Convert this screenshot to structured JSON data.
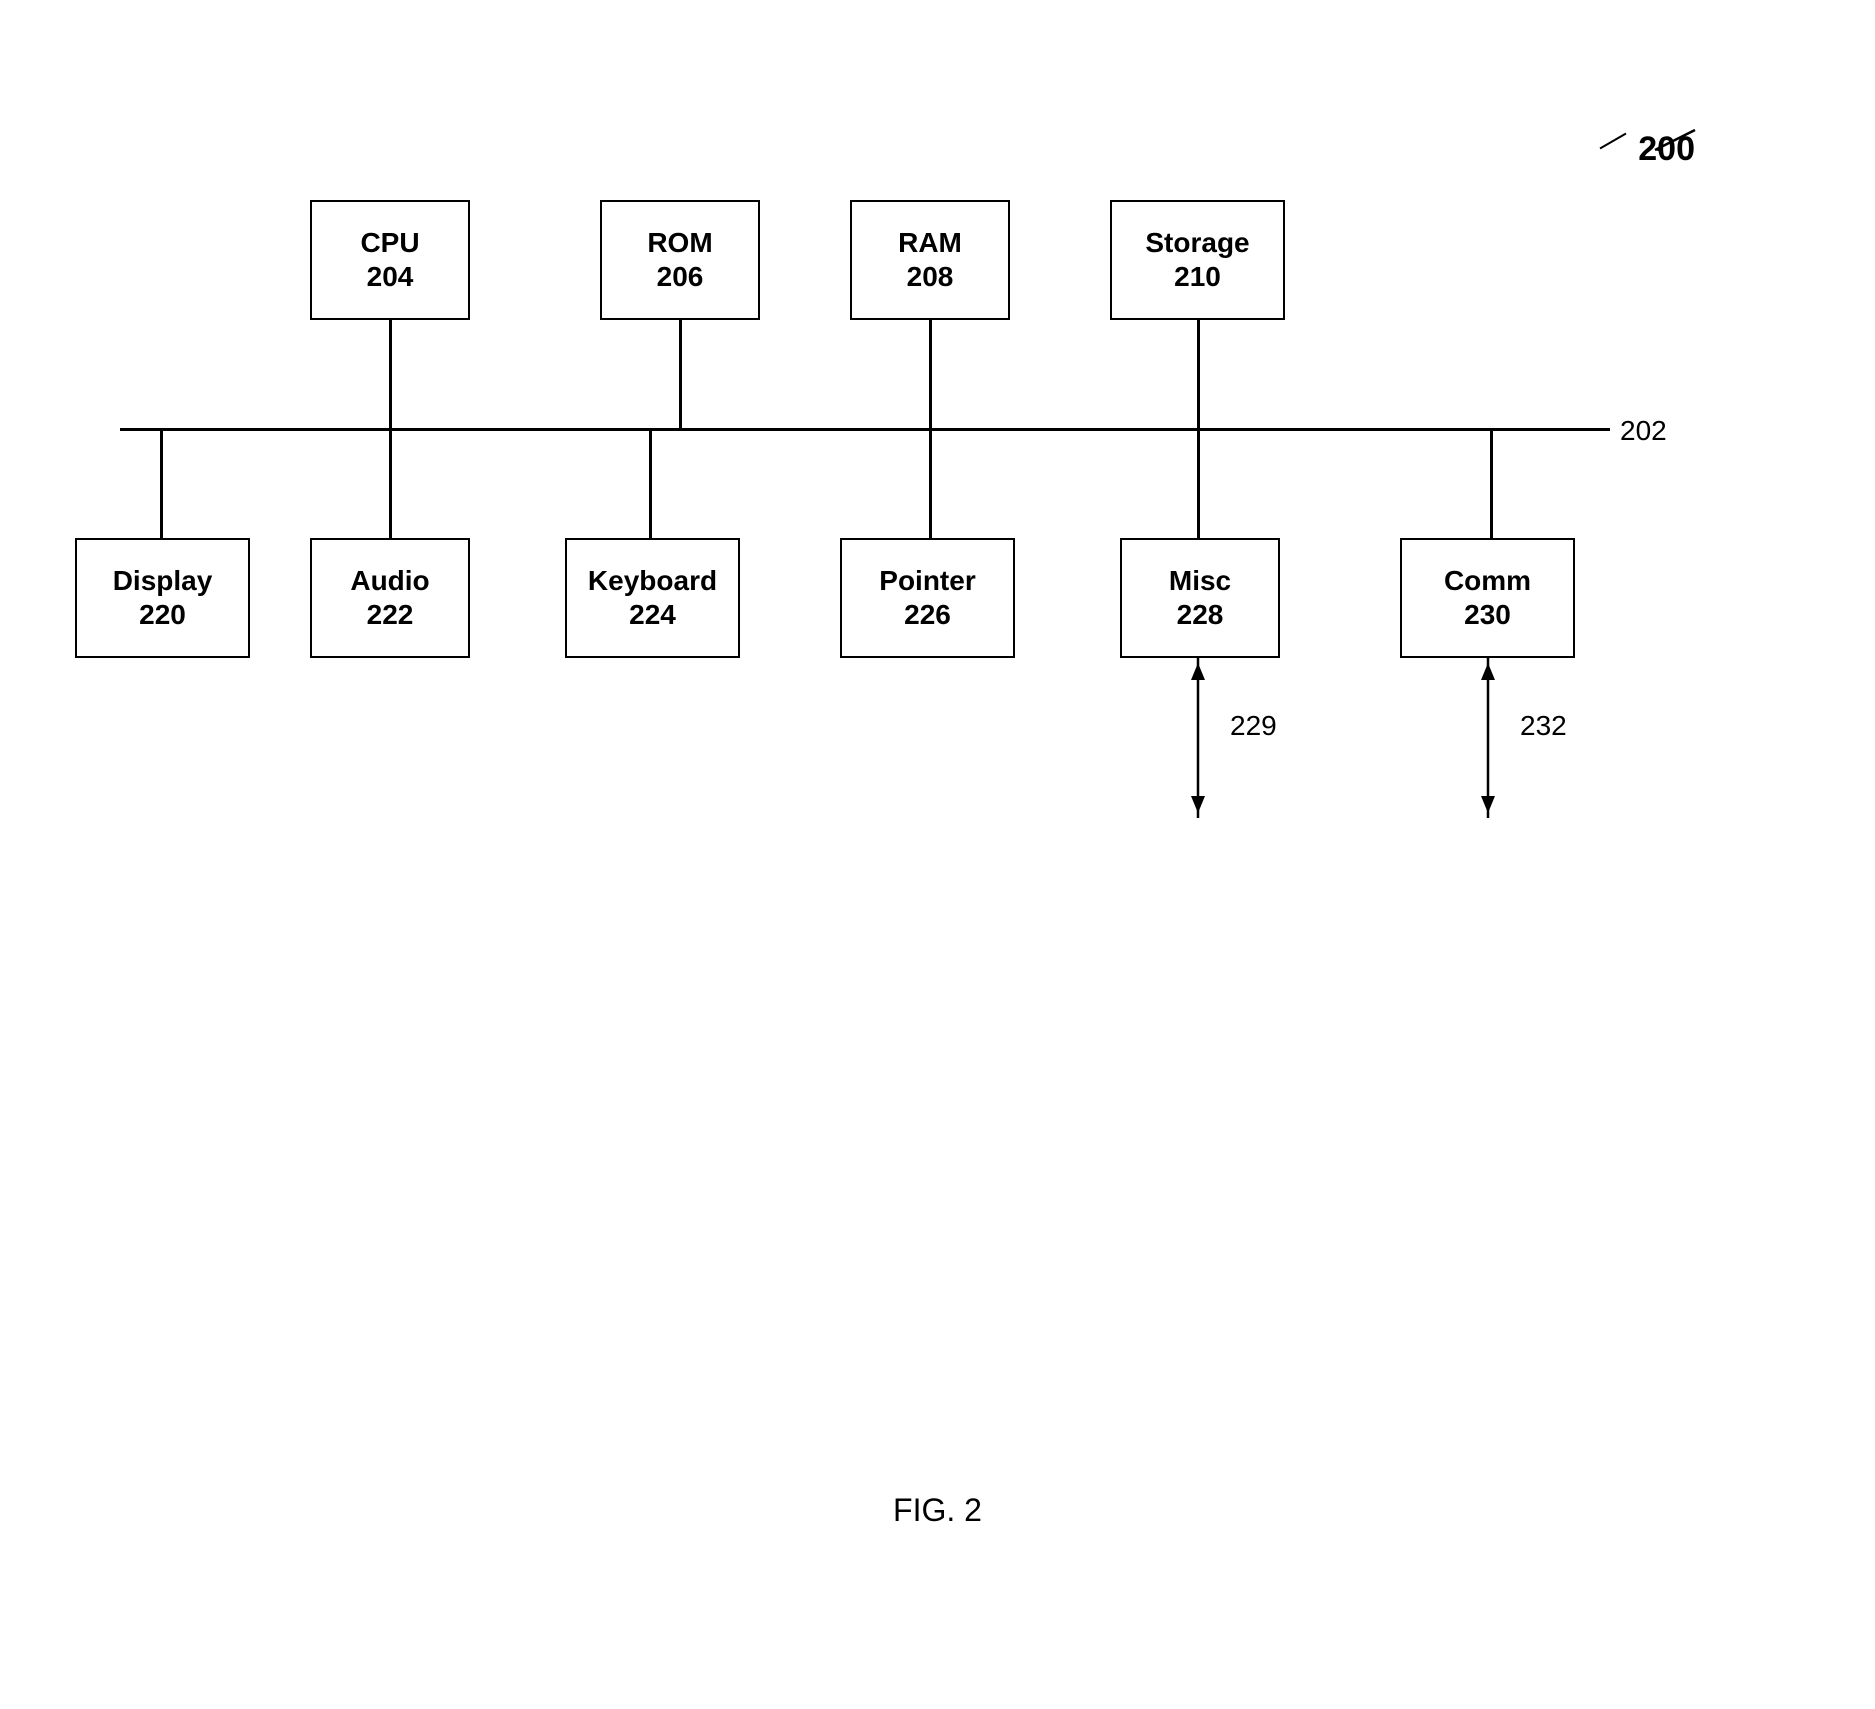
{
  "diagram": {
    "title": "FIG. 2",
    "ref_main": "200",
    "ref_bus": "202",
    "nodes": {
      "cpu": {
        "label": "CPU",
        "num": "204"
      },
      "rom": {
        "label": "ROM",
        "num": "206"
      },
      "ram": {
        "label": "RAM",
        "num": "208"
      },
      "storage": {
        "label": "Storage",
        "num": "210"
      },
      "display": {
        "label": "Display",
        "num": "220"
      },
      "audio": {
        "label": "Audio",
        "num": "222"
      },
      "keyboard": {
        "label": "Keyboard",
        "num": "224"
      },
      "pointer": {
        "label": "Pointer",
        "num": "226"
      },
      "misc": {
        "label": "Misc",
        "num": "228"
      },
      "comm": {
        "label": "Comm",
        "num": "230"
      }
    },
    "arrow_labels": {
      "misc_arrow": "229",
      "comm_arrow": "232"
    }
  }
}
